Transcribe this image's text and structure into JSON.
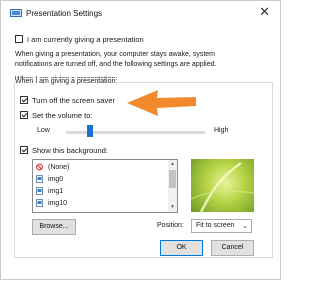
{
  "window": {
    "title": "Presentation Settings",
    "close_label": "✕"
  },
  "currently_presenting": {
    "label": "I am currently giving a presentation",
    "checked": false
  },
  "description": {
    "line1": "When giving a presentation, your computer stays awake, system",
    "line2": "notifications are turned off, and the following settings are applied."
  },
  "group": {
    "heading": "When I am giving a presentation:"
  },
  "screen_saver": {
    "label": "Turn off the screen saver",
    "checked": true
  },
  "volume": {
    "label": "Set the volume to:",
    "checked": true,
    "low_label": "Low",
    "high_label": "High",
    "level_fraction": 0.17
  },
  "background": {
    "label": "Show this background:",
    "checked": true,
    "items": [
      {
        "label": "(None)",
        "icon": "none-icon"
      },
      {
        "label": "img0",
        "icon": "image-file-icon"
      },
      {
        "label": "img1",
        "icon": "image-file-icon"
      },
      {
        "label": "img10",
        "icon": "image-file-icon"
      }
    ],
    "browse_label": "Browse...",
    "position_label": "Position:",
    "position_value": "Fit to screen"
  },
  "buttons": {
    "ok_label": "OK",
    "cancel_label": "Cancel"
  },
  "colors": {
    "accent": "#0078d7",
    "annotation_arrow": "#f08a2c",
    "slider_thumb": "#1e6fcf"
  }
}
